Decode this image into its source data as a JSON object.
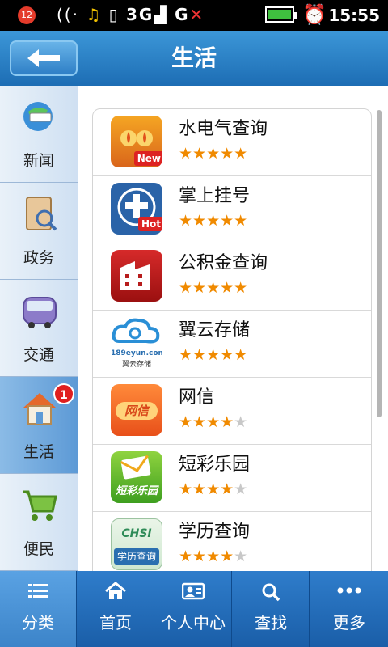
{
  "status": {
    "notification_count": "12",
    "network_label": "3G",
    "network_label2": "G",
    "time": "15:55"
  },
  "header": {
    "title": "生活",
    "back_icon": "back-arrow-icon"
  },
  "sidebar": {
    "items": [
      {
        "label": "新闻",
        "icon": "globe-icon",
        "active": false
      },
      {
        "label": "政务",
        "icon": "notebook-icon",
        "active": false
      },
      {
        "label": "交通",
        "icon": "bus-icon",
        "active": false
      },
      {
        "label": "生活",
        "icon": "house-icon",
        "active": true,
        "badge": "1"
      },
      {
        "label": "便民",
        "icon": "cart-icon",
        "active": false
      }
    ]
  },
  "apps": [
    {
      "name": "水电气查询",
      "rating": 5,
      "tag": "New",
      "icon": "utility-icon"
    },
    {
      "name": "掌上挂号",
      "rating": 5,
      "tag": "Hot",
      "icon": "hospital-icon"
    },
    {
      "name": "公积金查询",
      "rating": 5,
      "tag": "",
      "icon": "building-icon"
    },
    {
      "name": "翼云存储",
      "rating": 5,
      "tag": "",
      "icon": "cloud-icon",
      "icon_text": "189eyun.com",
      "icon_text2": "翼云存储"
    },
    {
      "name": "网信",
      "rating": 4,
      "tag": "",
      "icon": "wangxin-icon",
      "icon_text": "网信"
    },
    {
      "name": "短彩乐园",
      "rating": 4,
      "tag": "",
      "icon": "envelope-icon",
      "icon_text": "短彩乐园"
    },
    {
      "name": "学历查询",
      "rating": 4,
      "tag": "",
      "icon": "diploma-icon",
      "icon_text": "CHSI",
      "icon_text2": "学历查询"
    }
  ],
  "bottom_nav": [
    {
      "label": "分类",
      "icon": "list-icon",
      "active": true
    },
    {
      "label": "首页",
      "icon": "home-icon",
      "active": false
    },
    {
      "label": "个人中心",
      "icon": "profile-card-icon",
      "active": false
    },
    {
      "label": "查找",
      "icon": "search-icon",
      "active": false
    },
    {
      "label": "更多",
      "icon": "more-dots-icon",
      "active": false
    }
  ],
  "colors": {
    "accent": "#1d6db4",
    "star": "#f08a00",
    "badge": "#e01f1f"
  }
}
